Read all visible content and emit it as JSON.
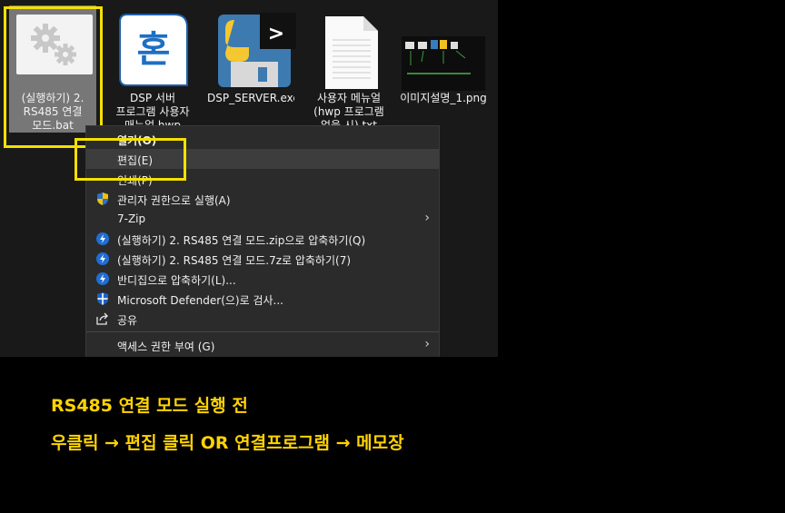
{
  "files": [
    {
      "label": "(실행하기) 2. RS485 연결 모드.bat",
      "icon": "gear-file-icon"
    },
    {
      "label": "DSP 서버 프로그램 사용자 매뉴얼.hwp",
      "icon": "hangul-doc-icon"
    },
    {
      "label": "DSP_SERVER.exe",
      "icon": "python-exe-icon"
    },
    {
      "label": "사용자 메뉴얼 (hwp 프로그램 없을 시).txt",
      "icon": "text-file-icon"
    },
    {
      "label": "이미지설명_1.png",
      "icon": "image-thumbnail-icon"
    }
  ],
  "context_menu": {
    "open": "열기(O)",
    "edit": "편집(E)",
    "print": "인쇄(P)",
    "run_as_admin": "관리자 권한으로 실행(A)",
    "zip7": "7-Zip",
    "compress_zip": "(실행하기) 2. RS485 연결 모드.zip으로 압축하기(Q)",
    "compress_7z": "(실행하기) 2. RS485 연결 모드.7z로 압축하기(7)",
    "bandizip": "반디집으로 압축하기(L)...",
    "defender": "Microsoft Defender(으)로 검사...",
    "share": "공유",
    "access": "액세스 권한 부여 (G)",
    "chevron": "›"
  },
  "caption": {
    "line1": "RS485 연결 모드 실행 전",
    "line2": "우클릭 → 편집 클릭 OR 연결프로그램 → 메모장"
  },
  "colors": {
    "highlight": "#f5e000",
    "caption": "#ffd400",
    "menu_bg": "#2b2b2b"
  }
}
